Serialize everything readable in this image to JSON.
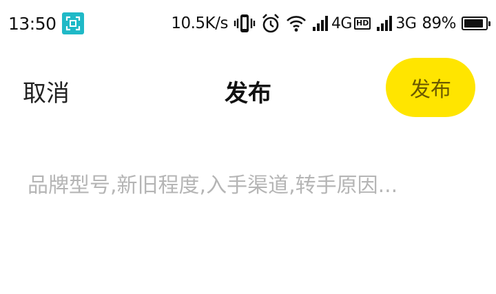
{
  "status_bar": {
    "time": "13:50",
    "net_speed": "10.5K/s",
    "sim1_label": "4G",
    "sim1_badge": "HD",
    "sim2_label": "3G",
    "battery_text": "89%",
    "battery_level": 0.89,
    "icons": [
      "scan-app-icon",
      "vibrate-icon",
      "alarm-icon",
      "wifi-icon",
      "signal-icon",
      "battery-icon"
    ]
  },
  "header": {
    "cancel_label": "取消",
    "title": "发布",
    "publish_label": "发布"
  },
  "compose": {
    "placeholder": "品牌型号,新旧程度,入手渠道,转手原因...",
    "value": ""
  },
  "colors": {
    "publish_bg": "#ffe500",
    "publish_text": "#6b5a00",
    "scan_badge": "#1fb9c7",
    "placeholder": "#b5b5b5"
  }
}
